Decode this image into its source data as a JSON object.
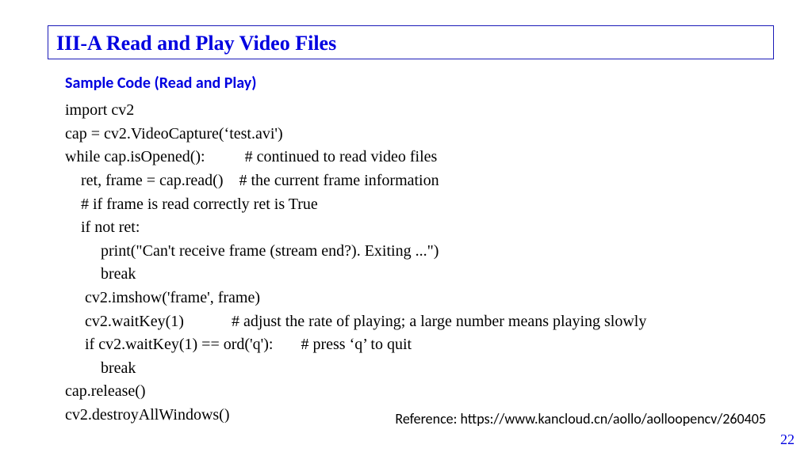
{
  "header": {
    "title": "III-A  Read and Play Video Files"
  },
  "subtitle": "Sample Code (Read and Play)",
  "code_lines": [
    "import cv2",
    "cap = cv2.VideoCapture(‘test.avi')",
    "while cap.isOpened():          # continued to read video files",
    "    ret, frame = cap.read()    # the current frame information",
    "    # if frame is read correctly ret is True",
    "    if not ret:",
    "         print(\"Can't receive frame (stream end?). Exiting ...\")",
    "         break",
    "     cv2.imshow('frame', frame)",
    "     cv2.waitKey(1)            # adjust the rate of playing; a large number means playing slowly",
    "     if cv2.waitKey(1) == ord('q'):       # press ‘q’ to quit",
    "         break",
    "cap.release()",
    "cv2.destroyAllWindows()"
  ],
  "reference": "Reference: https://www.kancloud.cn/aollo/aolloopencv/260405",
  "page_number": "22"
}
